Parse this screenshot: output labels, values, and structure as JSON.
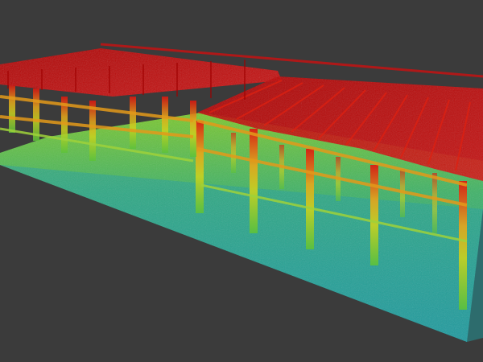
{
  "viewer": {
    "background": "#3b3b3b"
  },
  "colormap": {
    "name": "height-jet",
    "low": "#1fa3a0",
    "mid_low": "#3fb86a",
    "mid": "#7fd12e",
    "mid_high": "#e7c21a",
    "high": "#e0140e",
    "top": "#b80000"
  }
}
